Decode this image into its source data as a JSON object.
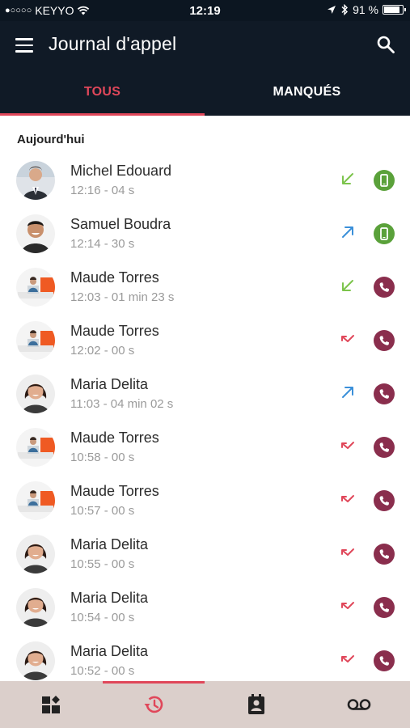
{
  "status_bar": {
    "carrier": "KEYYO",
    "signal_dots": "●○○○○",
    "time": "12:19",
    "battery": "91 %"
  },
  "app_bar": {
    "title": "Journal d'appel",
    "menu_icon": "hamburger-icon",
    "search_icon": "search-icon"
  },
  "tabs": [
    {
      "label": "TOUS",
      "selected": true
    },
    {
      "label": "MANQUÉS",
      "selected": false
    }
  ],
  "section": {
    "title": "Aujourd'hui"
  },
  "calls": [
    {
      "name": "Michel Edouard",
      "meta": "12:16 - 04 s",
      "direction": "incoming",
      "type": "mobile",
      "avatar": "man-suit"
    },
    {
      "name": "Samuel Boudra",
      "meta": "12:14 - 30 s",
      "direction": "outgoing",
      "type": "mobile",
      "avatar": "man-smile"
    },
    {
      "name": "Maude Torres",
      "meta": "12:03 - 01 min 23 s",
      "direction": "incoming",
      "type": "fixed",
      "avatar": "office-woman"
    },
    {
      "name": "Maude Torres",
      "meta": "12:02 - 00 s",
      "direction": "missed",
      "type": "fixed",
      "avatar": "office-woman"
    },
    {
      "name": "Maria Delita",
      "meta": "11:03 - 04 min 02 s",
      "direction": "outgoing",
      "type": "fixed",
      "avatar": "woman-dark-hair"
    },
    {
      "name": "Maude Torres",
      "meta": "10:58 - 00 s",
      "direction": "missed",
      "type": "fixed",
      "avatar": "office-woman"
    },
    {
      "name": "Maude Torres",
      "meta": "10:57 - 00 s",
      "direction": "missed",
      "type": "fixed",
      "avatar": "office-woman"
    },
    {
      "name": "Maria Delita",
      "meta": "10:55 - 00 s",
      "direction": "missed",
      "type": "fixed",
      "avatar": "woman-dark-hair"
    },
    {
      "name": "Maria Delita",
      "meta": "10:54 - 00 s",
      "direction": "missed",
      "type": "fixed",
      "avatar": "woman-dark-hair"
    },
    {
      "name": "Maria Delita",
      "meta": "10:52 - 00 s",
      "direction": "missed",
      "type": "fixed",
      "avatar": "woman-dark-hair"
    }
  ],
  "bottom_nav": [
    {
      "icon": "dashboard-icon",
      "selected": false
    },
    {
      "icon": "history-icon",
      "selected": true
    },
    {
      "icon": "contacts-icon",
      "selected": false
    },
    {
      "icon": "voicemail-icon",
      "selected": false
    }
  ],
  "colors": {
    "accent": "#e0475a",
    "header_bg": "#101a26",
    "incoming": "#7cc44c",
    "outgoing": "#3a8fd9",
    "missed": "#e0475a",
    "mobile_badge": "#5aa13a",
    "fixed_badge": "#8a2e4d",
    "bottom_bar": "#dbcfcb"
  }
}
